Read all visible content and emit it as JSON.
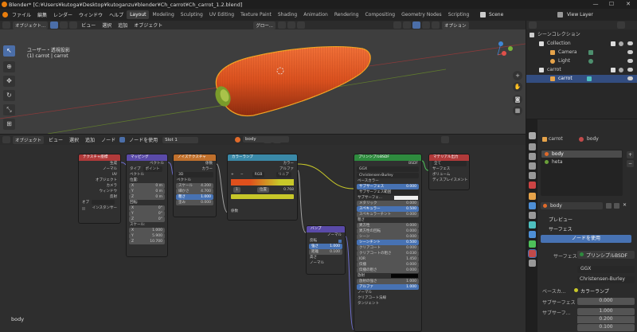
{
  "window": {
    "title": "Blender* [C:¥Users¥kutoga¥Desktop¥kutoganzu¥blender¥Ch_carrot¥Ch_carrot_1.2.blend]",
    "min": "—",
    "max": "☐",
    "close": "✕"
  },
  "menubar": {
    "menus": [
      "ファイル",
      "編集",
      "レンダー",
      "ウィンドウ",
      "ヘルプ"
    ],
    "workspaces": [
      "Layout",
      "Modeling",
      "Sculpting",
      "UV Editing",
      "Texture Paint",
      "Shading",
      "Animation",
      "Rendering",
      "Compositing",
      "Geometry Nodes",
      "Scripting"
    ],
    "active_workspace": "Layout",
    "scene": "Scene",
    "view_layer": "View Layer"
  },
  "viewport_header": {
    "mode": "オブジェクト...",
    "menus": [
      "ビュー",
      "選択",
      "追加",
      "オブジェクト"
    ],
    "transform": "グロー...",
    "options": "オプション"
  },
  "viewport": {
    "view_label": "ユーザー・透視投影",
    "object_label": "(1) carrot | carrot"
  },
  "outliner": {
    "title": "シーンコレクション",
    "rows": [
      {
        "label": "Collection",
        "depth": 1,
        "selected": false
      },
      {
        "label": "Camera",
        "depth": 2,
        "selected": false
      },
      {
        "label": "Light",
        "depth": 2,
        "selected": false
      },
      {
        "label": "carrot",
        "depth": 1,
        "selected": false
      },
      {
        "label": "carrot",
        "depth": 2,
        "selected": true
      }
    ]
  },
  "node_header": {
    "mode": "オブジェクト",
    "menus": [
      "ビュー",
      "選択",
      "追加",
      "ノード"
    ],
    "use_nodes": "ノードを使用",
    "slot": "Slot 1",
    "material": "body"
  },
  "nodes": {
    "texcoord": {
      "title": "テクスチャ座標",
      "outputs": [
        "生成",
        "ノーマル",
        "UV",
        "オブジェクト",
        "カメラ",
        "ウィンドウ",
        "反射"
      ],
      "object_label": "オブ",
      "instancer": "インスタンサー"
    },
    "mapping": {
      "title": "マッピング",
      "output": "ベクトル",
      "type_label": "タイプ",
      "type_value": "ポイント",
      "vector": "ベクトル",
      "location": "位置:",
      "rotation": "回転:",
      "scale": "スケール:",
      "axes": [
        "X",
        "Y",
        "Z"
      ],
      "loc_values": [
        "0 m",
        "0 m",
        "0 m"
      ],
      "rot_values": [
        "0°",
        "0°",
        "0°"
      ],
      "scale_values": [
        "1.000",
        "5.900",
        "10.700"
      ]
    },
    "noise": {
      "title": "ノイズテクスチャ",
      "out1": "係数",
      "out2": "カラー",
      "dim": "3D",
      "vector": "ベクトル",
      "rows": [
        {
          "label": "スケール",
          "value": "4.200"
        },
        {
          "label": "細かさ",
          "value": "4.700"
        },
        {
          "label": "粗さ",
          "value": "1.000"
        },
        {
          "label": "歪み",
          "value": "0.000"
        }
      ]
    },
    "ramp": {
      "title": "カラーランプ",
      "out1": "カラー",
      "out2": "アルファ",
      "mode": "RGB",
      "interp": "リニア",
      "index": "1",
      "pos_label": "位置",
      "pos_value": "0.768",
      "factor": "係数"
    },
    "bump": {
      "title": "バンプ",
      "out": "ノーマル",
      "invert": "反転",
      "rows": [
        {
          "label": "強さ",
          "value": "1.000"
        },
        {
          "label": "距離",
          "value": "0.100"
        }
      ],
      "in1": "高さ",
      "in2": "ノーマル"
    },
    "bsdf": {
      "title": "プリンシプルBSDF",
      "out": "BSDF",
      "dist": "GGX",
      "sss": "Christensen-Burley",
      "base": "ベースカラー",
      "rows": [
        {
          "label": "サブサーフェス",
          "value": "0.000"
        },
        {
          "label": "サブサーフェス範囲",
          "value": ""
        },
        {
          "label": "サブサーフェ...",
          "value": ""
        },
        {
          "label": "メタリック",
          "value": "0.000"
        },
        {
          "label": "スペキュラー",
          "value": "0.500"
        },
        {
          "label": "スペキュラーチント",
          "value": "0.000"
        },
        {
          "label": "粗さ",
          "value": ""
        },
        {
          "label": "異方性",
          "value": "0.000"
        },
        {
          "label": "異方性の回転",
          "value": "0.000"
        },
        {
          "label": "シーン",
          "value": "0.000"
        },
        {
          "label": "シーンチント",
          "value": "0.500"
        },
        {
          "label": "クリアコート",
          "value": "0.000"
        },
        {
          "label": "クリアコートの粗さ",
          "value": "0.030"
        },
        {
          "label": "IOR",
          "value": "1.450"
        },
        {
          "label": "伝播",
          "value": "0.000"
        },
        {
          "label": "伝播の粗さ",
          "value": "0.000"
        },
        {
          "label": "放射",
          "value": ""
        },
        {
          "label": "放射の強さ",
          "value": "1.000"
        },
        {
          "label": "アルファ",
          "value": "1.000"
        },
        {
          "label": "ノーマル",
          "value": ""
        },
        {
          "label": "クリアコート法線",
          "value": ""
        },
        {
          "label": "タンジェント",
          "value": ""
        }
      ]
    },
    "output": {
      "title": "マテリアル出力",
      "target": "全て",
      "inputs": [
        "サーフェス",
        "ボリューム",
        "ディスプレイスメント"
      ]
    }
  },
  "node_label": "body",
  "props": {
    "object": "carrot",
    "material": "body",
    "slots": [
      "body",
      "heta"
    ],
    "material_field": "body",
    "preview": "プレビュー",
    "surface_section": "サーフェス",
    "use_nodes": "ノードを使用",
    "surface_label": "サーフェス",
    "surface_value": "プリンシプルBSDF",
    "dist": "GGX",
    "sss": "Christensen-Burley",
    "base_label": "ベースカ...",
    "base_value": "カラーランプ",
    "sub_label": "サブサーフェス",
    "sub_value": "0.000",
    "sub2_label": "サブサーフ...",
    "sub2_values": [
      "1.000",
      "0.200",
      "0.100"
    ]
  },
  "colors": {
    "accent": "#4772b3",
    "input_node": "#b13a3a",
    "vector_node": "#5a4aa8",
    "texture_node": "#c0702c",
    "converter_node": "#3a89a8",
    "shader_node": "#2e8b3e",
    "output_node": "#b13a3a"
  }
}
